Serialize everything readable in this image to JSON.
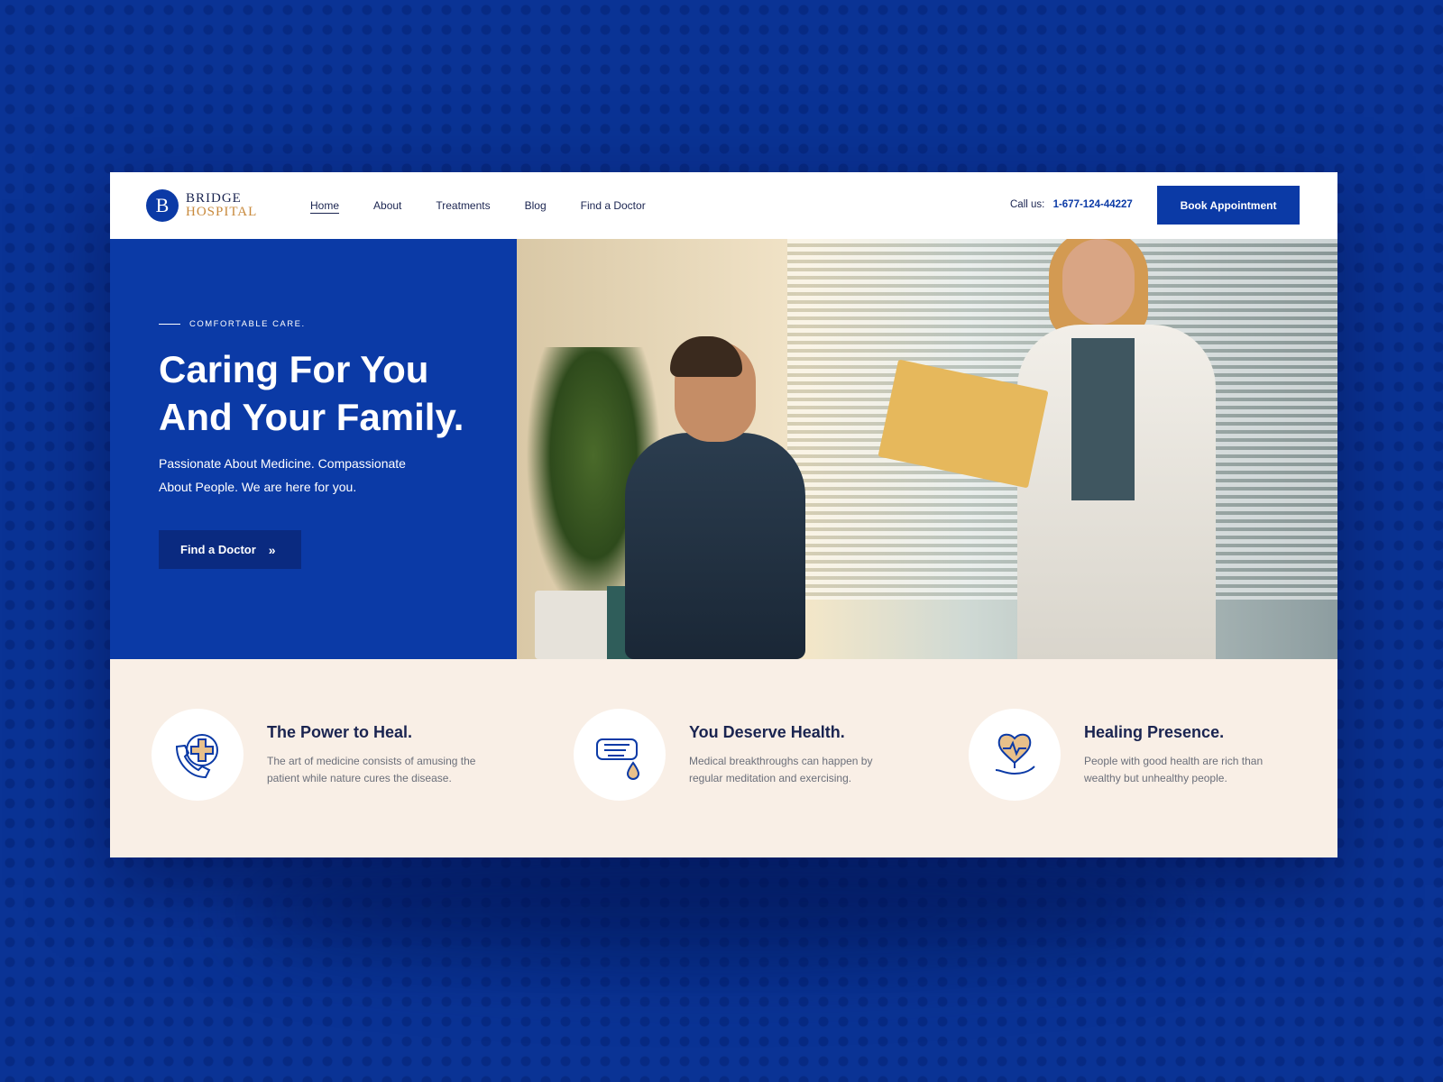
{
  "brand": {
    "mark": "B",
    "name_top": "BRIDGE",
    "name_bottom": "HOSPITAL"
  },
  "nav": [
    {
      "label": "Home",
      "active": true
    },
    {
      "label": "About",
      "active": false
    },
    {
      "label": "Treatments",
      "active": false
    },
    {
      "label": "Blog",
      "active": false
    },
    {
      "label": "Find a Doctor",
      "active": false
    }
  ],
  "contact": {
    "label": "Call us:",
    "phone": "1-677-124-44227"
  },
  "header_cta": "Book Appointment",
  "hero": {
    "eyebrow": "COMFORTABLE CARE.",
    "title": "Caring For You And Your Family.",
    "subtitle": "Passionate About Medicine. Compassionate About People. We are here for you.",
    "cta": "Find a Doctor",
    "cta_icon": "double-chevron-right-icon"
  },
  "features": [
    {
      "icon": "phone-medical-cross-icon",
      "title": "The Power to Heal.",
      "desc": "The art of medicine consists of amusing the patient while nature cures the disease."
    },
    {
      "icon": "finger-blood-drop-icon",
      "title": "You Deserve Health.",
      "desc": "Medical breakthroughs can happen by regular meditation and exercising."
    },
    {
      "icon": "heart-in-hand-icon",
      "title": "Healing Presence.",
      "desc": "People with good health are rich than wealthy but unhealthy people."
    }
  ],
  "colors": {
    "primary": "#0b3aa6",
    "accent": "#c8893b",
    "dark": "#1a2450",
    "cream": "#f9efe6"
  }
}
